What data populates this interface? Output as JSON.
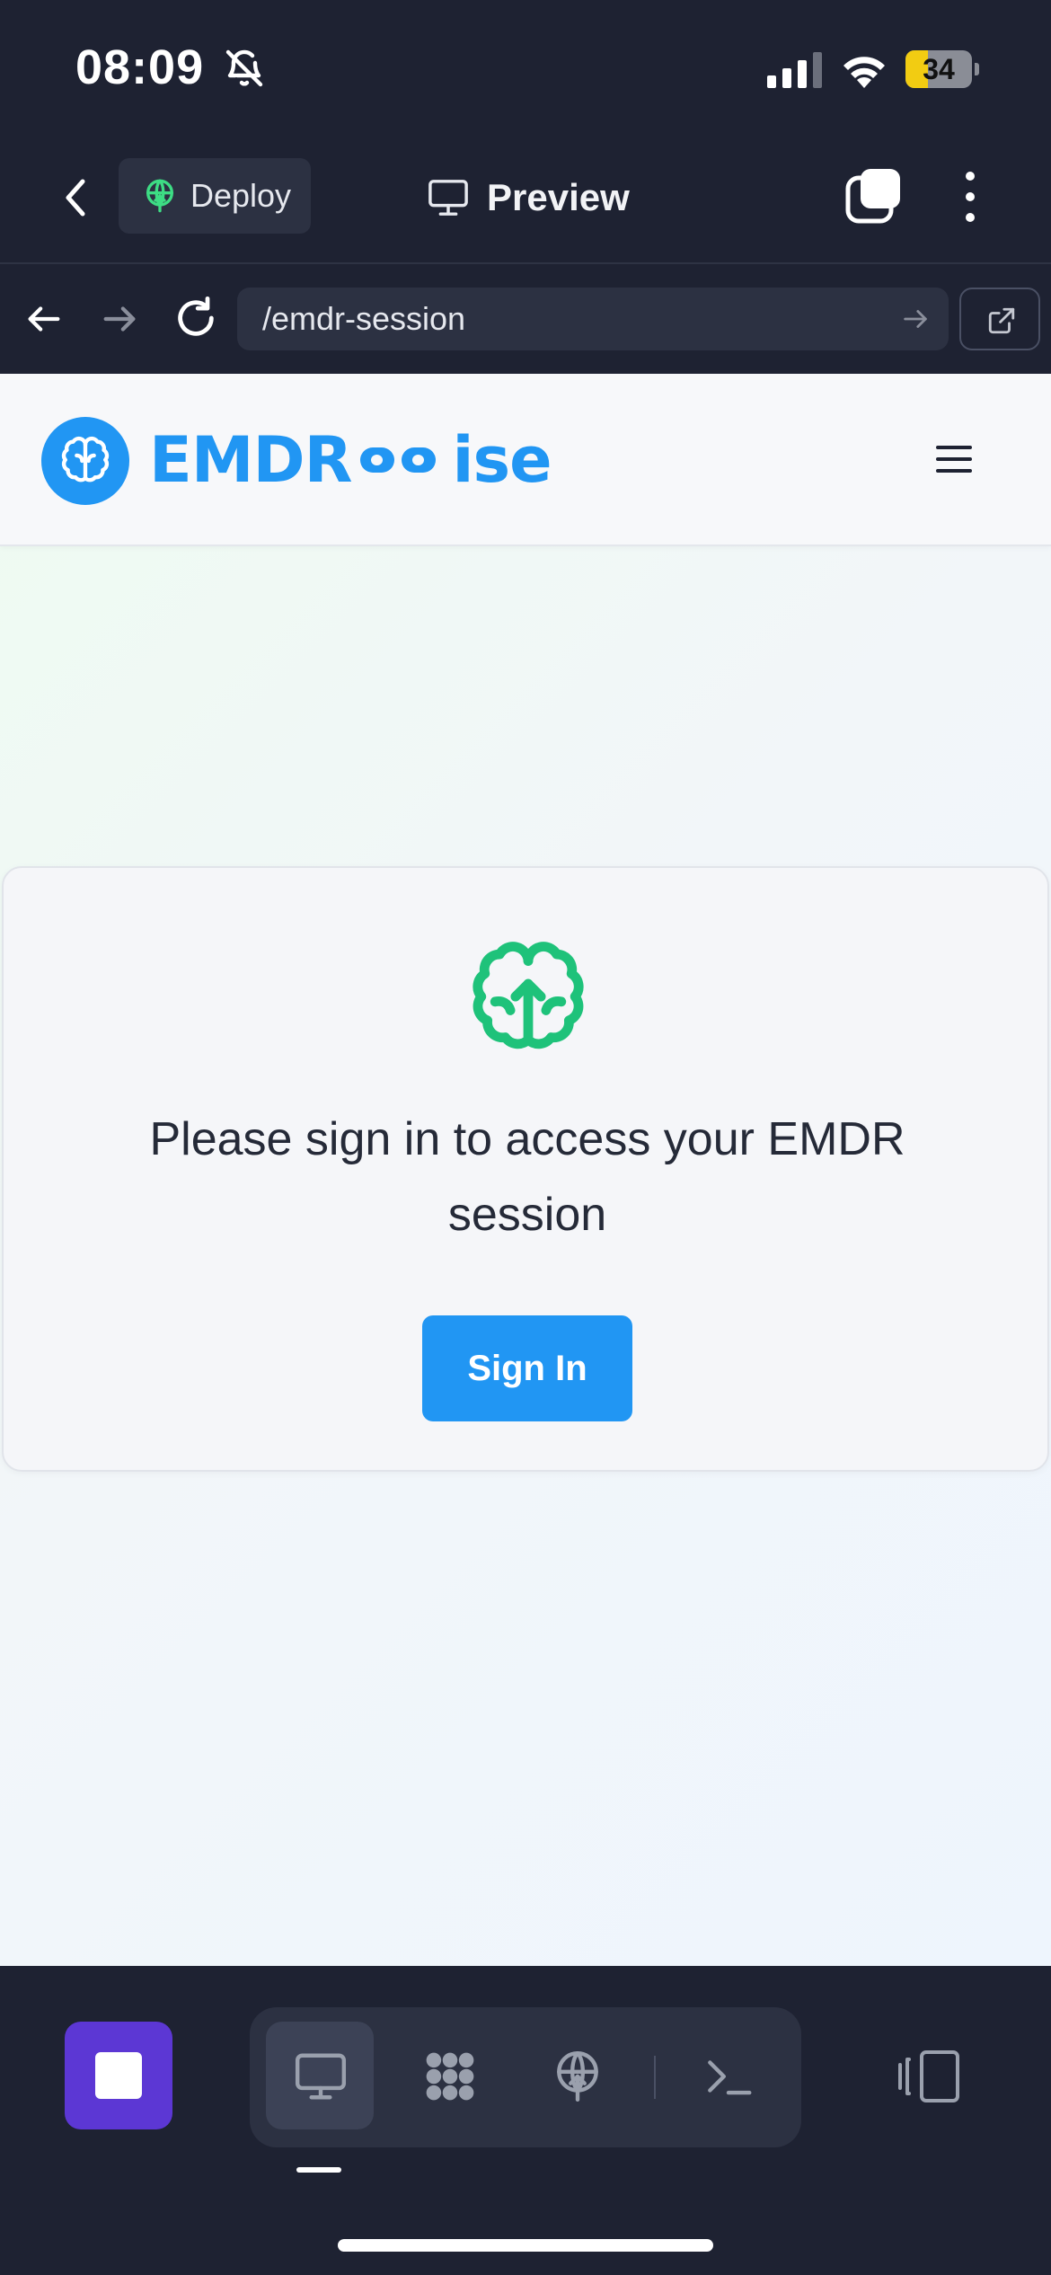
{
  "status_bar": {
    "time": "08:09",
    "battery_level": "34",
    "battery_fraction": 0.34,
    "icons": [
      "bell-slash-icon",
      "cellular-signal-icon",
      "wifi-icon",
      "battery-icon"
    ]
  },
  "toolbar": {
    "deploy_label": "Deploy",
    "preview_label": "Preview"
  },
  "url_bar": {
    "url": "/emdr-session"
  },
  "site": {
    "logo_left": "EMDR",
    "logo_right": "ise"
  },
  "signin_card": {
    "message": "Please sign in to access your EMDR session",
    "button_label": "Sign In"
  },
  "colors": {
    "chrome_bg": "#1e2232",
    "brand_blue": "#2196f3",
    "brain_green": "#1ec27a",
    "stop_purple": "#5c37d4",
    "battery_yellow": "#f2cc12"
  },
  "bottom_bar": {
    "tools": [
      "preview-tool",
      "workspace-tool",
      "deploy-tool",
      "console-tool"
    ],
    "active_tool": "preview-tool"
  }
}
